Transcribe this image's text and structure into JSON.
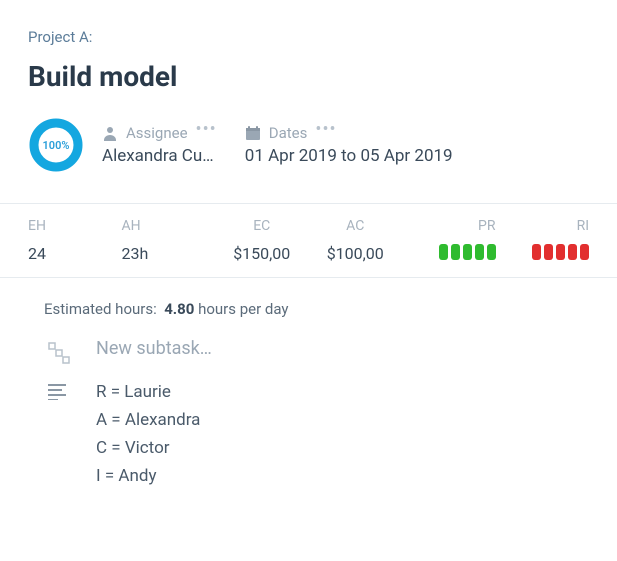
{
  "project_label": "Project A:",
  "task_title": "Build model",
  "progress": {
    "percent": 100,
    "display": "100%"
  },
  "assignee": {
    "label": "Assignee",
    "value": "Alexandra Cu…"
  },
  "dates": {
    "label": "Dates",
    "value": "01 Apr 2019 to 05 Apr 2019"
  },
  "stats": {
    "columns": [
      "EH",
      "AH",
      "EC",
      "AC",
      "PR",
      "RI"
    ],
    "values": {
      "eh": "24",
      "ah": "23h",
      "ec": "$150,00",
      "ac": "$100,00"
    },
    "pr": {
      "color": "green",
      "count": 5
    },
    "ri": {
      "color": "red",
      "count": 5
    }
  },
  "estimated_hours": {
    "label": "Estimated hours:",
    "value": "4.80",
    "suffix": "hours per day"
  },
  "subtask_placeholder": "New subtask…",
  "raci": [
    "R = Laurie",
    "A = Alexandra",
    "C = Victor",
    "I = Andy"
  ]
}
